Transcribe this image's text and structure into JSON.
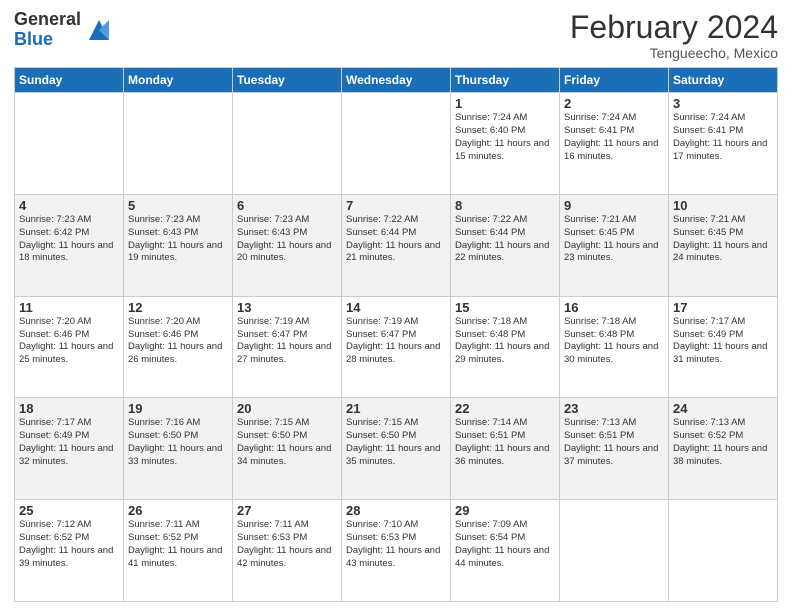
{
  "logo": {
    "general": "General",
    "blue": "Blue"
  },
  "title": "February 2024",
  "subtitle": "Tengueecho, Mexico",
  "days_of_week": [
    "Sunday",
    "Monday",
    "Tuesday",
    "Wednesday",
    "Thursday",
    "Friday",
    "Saturday"
  ],
  "weeks": [
    [
      {
        "day": "",
        "info": ""
      },
      {
        "day": "",
        "info": ""
      },
      {
        "day": "",
        "info": ""
      },
      {
        "day": "",
        "info": ""
      },
      {
        "day": "1",
        "info": "Sunrise: 7:24 AM\nSunset: 6:40 PM\nDaylight: 11 hours\nand 15 minutes."
      },
      {
        "day": "2",
        "info": "Sunrise: 7:24 AM\nSunset: 6:41 PM\nDaylight: 11 hours\nand 16 minutes."
      },
      {
        "day": "3",
        "info": "Sunrise: 7:24 AM\nSunset: 6:41 PM\nDaylight: 11 hours\nand 17 minutes."
      }
    ],
    [
      {
        "day": "4",
        "info": "Sunrise: 7:23 AM\nSunset: 6:42 PM\nDaylight: 11 hours\nand 18 minutes."
      },
      {
        "day": "5",
        "info": "Sunrise: 7:23 AM\nSunset: 6:43 PM\nDaylight: 11 hours\nand 19 minutes."
      },
      {
        "day": "6",
        "info": "Sunrise: 7:23 AM\nSunset: 6:43 PM\nDaylight: 11 hours\nand 20 minutes."
      },
      {
        "day": "7",
        "info": "Sunrise: 7:22 AM\nSunset: 6:44 PM\nDaylight: 11 hours\nand 21 minutes."
      },
      {
        "day": "8",
        "info": "Sunrise: 7:22 AM\nSunset: 6:44 PM\nDaylight: 11 hours\nand 22 minutes."
      },
      {
        "day": "9",
        "info": "Sunrise: 7:21 AM\nSunset: 6:45 PM\nDaylight: 11 hours\nand 23 minutes."
      },
      {
        "day": "10",
        "info": "Sunrise: 7:21 AM\nSunset: 6:45 PM\nDaylight: 11 hours\nand 24 minutes."
      }
    ],
    [
      {
        "day": "11",
        "info": "Sunrise: 7:20 AM\nSunset: 6:46 PM\nDaylight: 11 hours\nand 25 minutes."
      },
      {
        "day": "12",
        "info": "Sunrise: 7:20 AM\nSunset: 6:46 PM\nDaylight: 11 hours\nand 26 minutes."
      },
      {
        "day": "13",
        "info": "Sunrise: 7:19 AM\nSunset: 6:47 PM\nDaylight: 11 hours\nand 27 minutes."
      },
      {
        "day": "14",
        "info": "Sunrise: 7:19 AM\nSunset: 6:47 PM\nDaylight: 11 hours\nand 28 minutes."
      },
      {
        "day": "15",
        "info": "Sunrise: 7:18 AM\nSunset: 6:48 PM\nDaylight: 11 hours\nand 29 minutes."
      },
      {
        "day": "16",
        "info": "Sunrise: 7:18 AM\nSunset: 6:48 PM\nDaylight: 11 hours\nand 30 minutes."
      },
      {
        "day": "17",
        "info": "Sunrise: 7:17 AM\nSunset: 6:49 PM\nDaylight: 11 hours\nand 31 minutes."
      }
    ],
    [
      {
        "day": "18",
        "info": "Sunrise: 7:17 AM\nSunset: 6:49 PM\nDaylight: 11 hours\nand 32 minutes."
      },
      {
        "day": "19",
        "info": "Sunrise: 7:16 AM\nSunset: 6:50 PM\nDaylight: 11 hours\nand 33 minutes."
      },
      {
        "day": "20",
        "info": "Sunrise: 7:15 AM\nSunset: 6:50 PM\nDaylight: 11 hours\nand 34 minutes."
      },
      {
        "day": "21",
        "info": "Sunrise: 7:15 AM\nSunset: 6:50 PM\nDaylight: 11 hours\nand 35 minutes."
      },
      {
        "day": "22",
        "info": "Sunrise: 7:14 AM\nSunset: 6:51 PM\nDaylight: 11 hours\nand 36 minutes."
      },
      {
        "day": "23",
        "info": "Sunrise: 7:13 AM\nSunset: 6:51 PM\nDaylight: 11 hours\nand 37 minutes."
      },
      {
        "day": "24",
        "info": "Sunrise: 7:13 AM\nSunset: 6:52 PM\nDaylight: 11 hours\nand 38 minutes."
      }
    ],
    [
      {
        "day": "25",
        "info": "Sunrise: 7:12 AM\nSunset: 6:52 PM\nDaylight: 11 hours\nand 39 minutes."
      },
      {
        "day": "26",
        "info": "Sunrise: 7:11 AM\nSunset: 6:52 PM\nDaylight: 11 hours\nand 41 minutes."
      },
      {
        "day": "27",
        "info": "Sunrise: 7:11 AM\nSunset: 6:53 PM\nDaylight: 11 hours\nand 42 minutes."
      },
      {
        "day": "28",
        "info": "Sunrise: 7:10 AM\nSunset: 6:53 PM\nDaylight: 11 hours\nand 43 minutes."
      },
      {
        "day": "29",
        "info": "Sunrise: 7:09 AM\nSunset: 6:54 PM\nDaylight: 11 hours\nand 44 minutes."
      },
      {
        "day": "",
        "info": ""
      },
      {
        "day": "",
        "info": ""
      }
    ]
  ]
}
